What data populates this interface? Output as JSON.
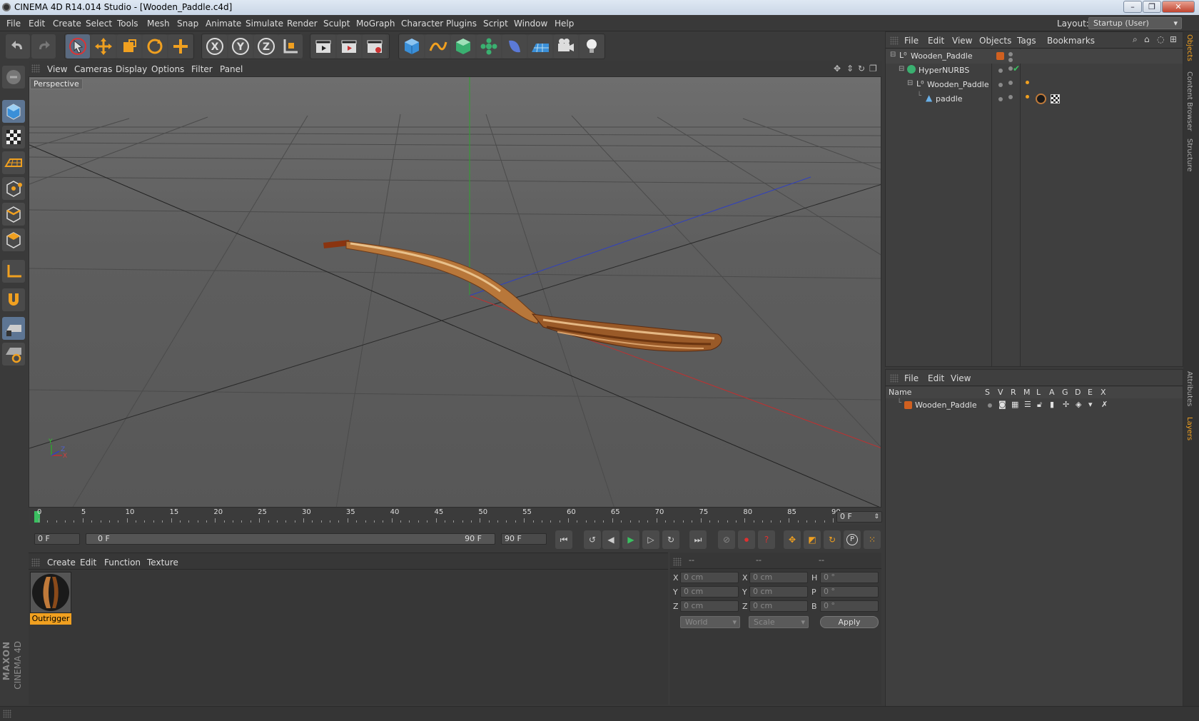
{
  "window": {
    "title": "CINEMA 4D R14.014 Studio - [Wooden_Paddle.c4d]",
    "min": "–",
    "max": "❐",
    "close": "✕"
  },
  "menu": [
    "File",
    "Edit",
    "Create",
    "Select",
    "Tools",
    "Mesh",
    "Snap",
    "Animate",
    "Simulate",
    "Render",
    "Sculpt",
    "MoGraph",
    "Character",
    "Plugins",
    "Script",
    "Window",
    "Help"
  ],
  "layout": {
    "label": "Layout:",
    "value": "Startup (User)"
  },
  "toolbar_axes": {
    "x": "X",
    "y": "Y",
    "z": "Z"
  },
  "viewport_menu": [
    "View",
    "Cameras",
    "Display",
    "Options",
    "Filter",
    "Panel"
  ],
  "viewport": {
    "label": "Perspective",
    "axis_x": "X",
    "axis_y": "Y",
    "axis_z": "Z"
  },
  "timeline": {
    "labels": [
      "0",
      "5",
      "10",
      "15",
      "20",
      "25",
      "30",
      "35",
      "40",
      "45",
      "50",
      "55",
      "60",
      "65",
      "70",
      "75",
      "80",
      "85",
      "90"
    ],
    "current_frame": "0 F"
  },
  "transport": {
    "start": "0 F",
    "range_start": "0 F",
    "range_end": "90 F",
    "end": "90 F",
    "key_label": "P"
  },
  "materials": {
    "menu": [
      "Create",
      "Edit",
      "Function",
      "Texture"
    ],
    "items": [
      {
        "name": "Outrigger"
      }
    ]
  },
  "coords": {
    "headers": [
      "--",
      "--",
      "--"
    ],
    "rows": [
      {
        "a": "X",
        "av": "0 cm",
        "b": "X",
        "bv": "0 cm",
        "c": "H",
        "cv": "0 °"
      },
      {
        "a": "Y",
        "av": "0 cm",
        "b": "Y",
        "bv": "0 cm",
        "c": "P",
        "cv": "0 °"
      },
      {
        "a": "Z",
        "av": "0 cm",
        "b": "Z",
        "bv": "0 cm",
        "c": "B",
        "cv": "0 °"
      }
    ],
    "space": "World",
    "mode": "Scale",
    "apply": "Apply"
  },
  "objects": {
    "menu": [
      "File",
      "Edit",
      "View",
      "Objects",
      "Tags",
      "Bookmarks"
    ],
    "tree": [
      {
        "name": "Wooden_Paddle",
        "indent": 0
      },
      {
        "name": "HyperNURBS",
        "indent": 1
      },
      {
        "name": "Wooden_Paddle",
        "indent": 2
      },
      {
        "name": "paddle",
        "indent": 3
      }
    ]
  },
  "layers": {
    "menu": [
      "File",
      "Edit",
      "View"
    ],
    "columns": [
      "Name",
      "S",
      "V",
      "R",
      "M",
      "L",
      "A",
      "G",
      "D",
      "E",
      "X"
    ],
    "rows": [
      {
        "name": "Wooden_Paddle"
      }
    ]
  },
  "side_tabs": [
    "Objects",
    "Content Browser",
    "Structure",
    "Attributes",
    "Layers"
  ],
  "brand": {
    "maxon": "MAXON",
    "product": "CINEMA 4D"
  },
  "colors": {
    "accent": "#f0a020",
    "axis_x": "#c03030",
    "axis_y": "#30a030",
    "axis_z": "#3040c0",
    "layer_color": "#d06020"
  }
}
